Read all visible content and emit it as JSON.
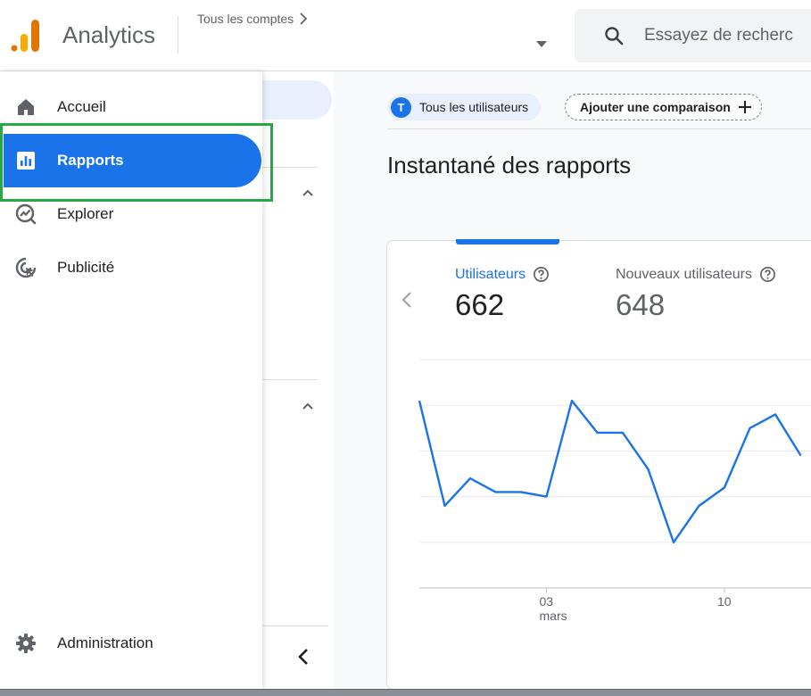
{
  "header": {
    "app_title": "Analytics",
    "account_crumb": "Tous les comptes",
    "search_placeholder": "Essayez de recherc"
  },
  "nav": {
    "items": [
      {
        "label": "Accueil",
        "icon": "home-icon"
      },
      {
        "label": "Rapports",
        "icon": "bar-chart-icon",
        "active": true
      },
      {
        "label": "Explorer",
        "icon": "explore-icon"
      },
      {
        "label": "Publicité",
        "icon": "advertising-icon"
      }
    ],
    "admin_label": "Administration"
  },
  "toolbar": {
    "user_chip_initial": "T",
    "user_chip_label": "Tous les utilisateurs",
    "compare_label": "Ajouter une comparaison"
  },
  "page": {
    "title": "Instantané des rapports"
  },
  "card": {
    "metrics": [
      {
        "label": "Utilisateurs",
        "value": "662",
        "selected": true
      },
      {
        "label": "Nouveaux utilisateurs",
        "value": "648"
      }
    ],
    "chart_data": {
      "type": "line",
      "title": "",
      "xlabel": "",
      "ylabel": "",
      "x_tick_labels": [
        {
          "day": "03",
          "month": "mars"
        },
        {
          "day": "10",
          "month": ""
        }
      ],
      "series": [
        {
          "values": [
            41,
            18,
            24,
            21,
            21,
            20,
            41,
            34,
            34,
            26,
            10,
            18,
            22,
            35,
            38,
            29
          ]
        }
      ],
      "ylim": [
        0,
        50
      ],
      "grid": true,
      "color": "#1a73e8"
    }
  },
  "colors": {
    "accent": "#1a73e8",
    "highlight": "#27a844"
  }
}
